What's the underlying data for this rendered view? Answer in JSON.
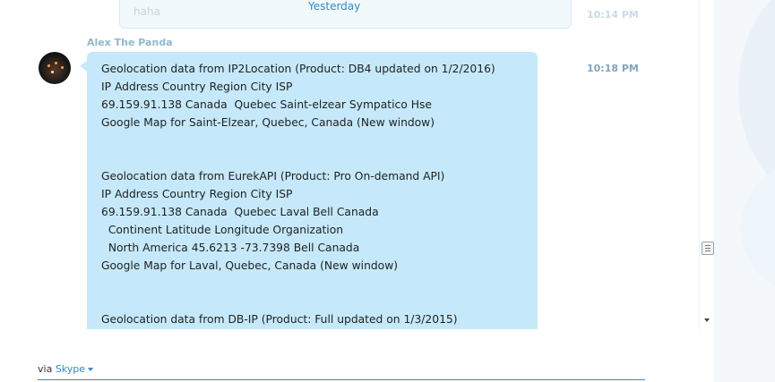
{
  "previous_message": {
    "text": "haha",
    "time": "10:14 PM"
  },
  "date_separator": "Yesterday",
  "message": {
    "sender": "Alex The Panda",
    "time": "10:18 PM",
    "lines": [
      "Geolocation data from IP2Location (Product: DB4 updated on 1/2/2016)",
      "IP Address Country Region City ISP",
      "69.159.91.138 Canada  Quebec Saint-elzear Sympatico Hse",
      "Google Map for Saint-Elzear, Quebec, Canada (New window)",
      "",
      "",
      "Geolocation data from EurekAPI (Product: Pro On-demand API)",
      "IP Address Country Region City ISP",
      "69.159.91.138 Canada  Quebec Laval Bell Canada",
      "  Continent Latitude Longitude Organization",
      "  North America 45.6213 -73.7398 Bell Canada",
      "Google Map for Laval, Quebec, Canada (New window)",
      "",
      "",
      "Geolocation data from DB-IP (Product: Full updated on 1/3/2015)"
    ]
  },
  "compose": {
    "via_label": "via",
    "service": "Skype"
  },
  "colors": {
    "bubble": "#c5e9fa",
    "accent": "#2e8bc9"
  }
}
